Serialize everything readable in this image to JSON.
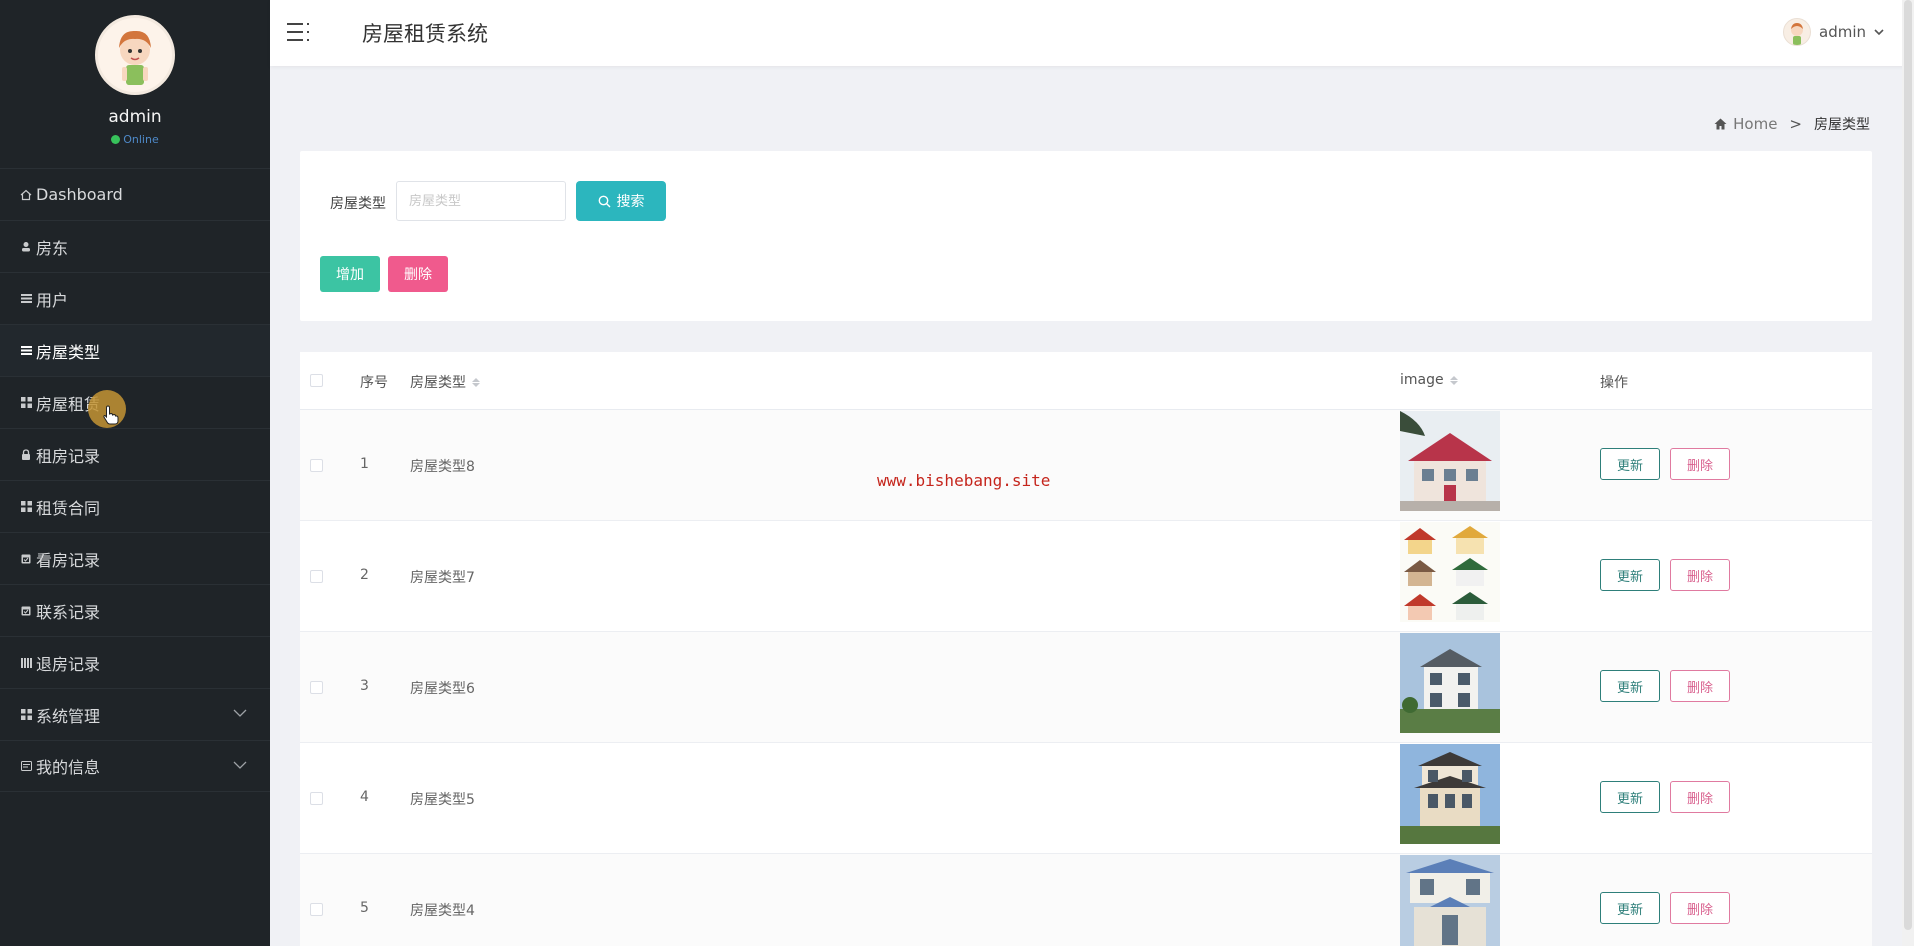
{
  "sidebar": {
    "profile_name": "admin",
    "status": "Online",
    "items": [
      {
        "label": "Dashboard",
        "icon": "home-icon"
      },
      {
        "label": "房东",
        "icon": "user-icon"
      },
      {
        "label": "用户",
        "icon": "list-icon"
      },
      {
        "label": "房屋类型",
        "icon": "list-icon",
        "active": true
      },
      {
        "label": "房屋租赁",
        "icon": "grid-icon"
      },
      {
        "label": "租房记录",
        "icon": "lock-icon"
      },
      {
        "label": "租赁合同",
        "icon": "grid-icon"
      },
      {
        "label": "看房记录",
        "icon": "calendar-icon"
      },
      {
        "label": "联系记录",
        "icon": "calendar-icon"
      },
      {
        "label": "退房记录",
        "icon": "bars-icon"
      },
      {
        "label": "系统管理",
        "icon": "grid-icon",
        "expandable": true
      },
      {
        "label": "我的信息",
        "icon": "card-icon",
        "expandable": true
      }
    ]
  },
  "header": {
    "title": "房屋租赁系统",
    "user": "admin"
  },
  "breadcrumb": {
    "home": "Home",
    "separator": ">",
    "current": "房屋类型"
  },
  "search": {
    "label": "房屋类型",
    "placeholder": "房屋类型",
    "button": "搜索",
    "add_button": "增加",
    "delete_button": "删除"
  },
  "table": {
    "columns": {
      "index": "序号",
      "type": "房屋类型",
      "image": "image",
      "actions": "操作"
    },
    "rows": [
      {
        "index": "1",
        "type": "房屋类型8"
      },
      {
        "index": "2",
        "type": "房屋类型7"
      },
      {
        "index": "3",
        "type": "房屋类型6"
      },
      {
        "index": "4",
        "type": "房屋类型5"
      },
      {
        "index": "5",
        "type": "房屋类型4"
      }
    ],
    "update_label": "更新",
    "delete_label": "删除"
  },
  "watermark": "www.bishebang.site",
  "colors": {
    "sidebar_bg": "#1f2428",
    "search_button": "#2cb6be",
    "add_button": "#3cc4a3",
    "delete_button": "#f05a8d",
    "watermark": "#c5251c"
  }
}
